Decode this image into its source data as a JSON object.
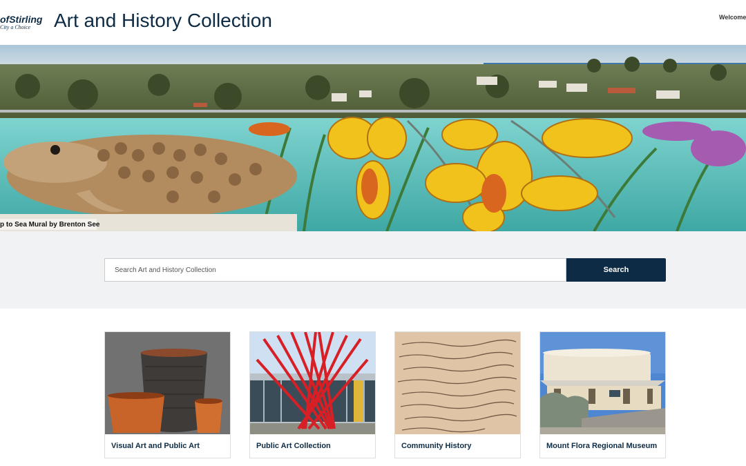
{
  "header": {
    "logo_main": "ofStirling",
    "logo_sub": "City a Choice",
    "title": "Art and History Collection",
    "welcome": "Welcome G"
  },
  "hero": {
    "caption": "p to Sea Mural by Brenton See"
  },
  "search": {
    "placeholder": "Search Art and History Collection",
    "value": "",
    "button_label": "Search"
  },
  "cards": [
    {
      "label": "Visual Art and Public Art",
      "icon": "ceramic-pots-image"
    },
    {
      "label": "Public Art Collection",
      "icon": "red-sculpture-image"
    },
    {
      "label": "Community History",
      "icon": "handwritten-ledger-image"
    },
    {
      "label": "Mount Flora Regional Museum",
      "icon": "museum-building-image"
    }
  ],
  "colors": {
    "brand_navy": "#0d2b45",
    "search_band": "#f1f2f3"
  }
}
